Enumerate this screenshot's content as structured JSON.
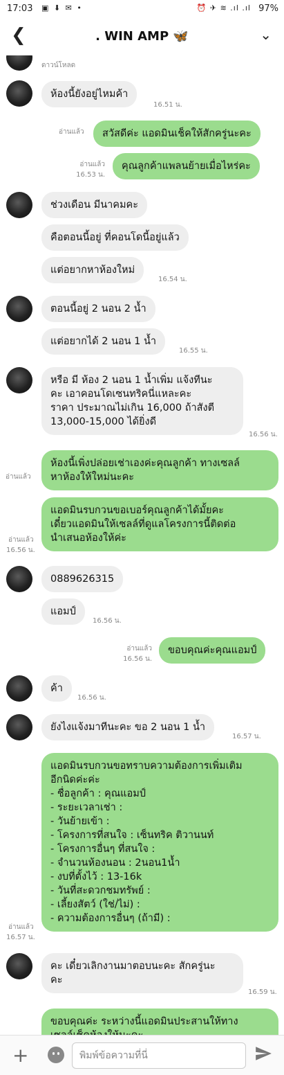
{
  "status": {
    "time": "17:03",
    "left_icons": "▣ ⬇ ✉ •",
    "right_icons": "⏰ ✈ ≋ .ıl .ıl",
    "battery": "97%"
  },
  "header": {
    "back": "❮",
    "title": ". WIN AMP 🦋",
    "chevron": "⌄"
  },
  "chat": {
    "first_caption": "ดาวน์โหลด",
    "m1": {
      "text": "ห้องนี้ยังอยู่ไหมค้า",
      "time": "16.51 น."
    },
    "m2": {
      "read": "อ่านแล้ว",
      "text": "สวัสดีค่ะ แอดมินเช็คให้สักครู่นะคะ"
    },
    "m3": {
      "read": "อ่านแล้ว",
      "time": "16.53 น.",
      "text": "คุณลูกค้าแพลนย้ายเมื่อไหร่คะ"
    },
    "m4": {
      "text": "ช่วงเดือน มีนาคมคะ"
    },
    "m5": {
      "text": "คือตอนนี้อยู่ ที่คอนโดนี้อยู่แล้ว"
    },
    "m6": {
      "text": "แต่อยากหาห้องใหม่",
      "time": "16.54 น."
    },
    "m7": {
      "text": "ตอนนี้อยู่ 2 นอน 2 น้ำ"
    },
    "m8": {
      "text": "แต่อยากได้ 2 นอน 1 น้ำ",
      "time": "16.55 น."
    },
    "m9": {
      "text": "หรือ มี ห้อง 2 นอน 1 น้ำเพิ่ม แจ้งทีนะ\nคะ เอาคอนโดเซนทริคนี่แหละคะ\nราคา ประมาณไม่เกิน 16,000 ถ้าสังตี\n13,000-15,000 ได้ยิ่งดี",
      "time": "16.56 น."
    },
    "m10": {
      "read": "อ่านแล้ว",
      "text": "ห้องนี้เพิ่งปล่อยเช่าเองค่ะคุณลูกค้า ทางเซลล์\nหาห้องให้ใหม่นะคะ"
    },
    "m11": {
      "read": "อ่านแล้ว",
      "time": "16.56 น.",
      "text": "แอดมินรบกวนขอเบอร์คุณลูกค้าได้มั้ยคะ\nเดี๋ยวแอดมินให้เซลล์ที่ดูแลโครงการนี้ติดต่อ\nนำเสนอห้องให้ค่ะ"
    },
    "m12": {
      "text": "0889626315"
    },
    "m13": {
      "text": "แอมป์",
      "time": "16.56 น."
    },
    "m14": {
      "read": "อ่านแล้ว",
      "time": "16.56 น.",
      "text": "ขอบคุณค่ะคุณแอมป์"
    },
    "m15": {
      "text": "ค้า",
      "time": "16.56 น."
    },
    "m16": {
      "text": "ยังไงแจ้งมาทีนะคะ ขอ 2 นอน 1 น้ำ",
      "time": "16.57 น."
    },
    "m17": {
      "read": "อ่านแล้ว",
      "time": "16.57 น.",
      "text": "แอดมินรบกวนขอทราบความต้องการเพิ่มเติม\nอีกนิดค่ะค่ะ\n- ชื่อลูกค้า : คุณแอมป์\n- ระยะเวลาเช่า :\n- วันย้ายเข้า :\n- โครงการที่สนใจ : เซ็นทริค ติวานนท์\n- โครงการอื่นๆ ที่สนใจ :\n- จำนวนห้องนอน : 2นอน1น้ำ\n- งบที่ตั้งไว้ : 13-16k\n- วันที่สะดวกชมทรัพย์ :\n- เลี้ยงสัตว์ (ใช่/ไม่) :\n- ความต้องการอื่นๆ (ถ้ามี) :"
    },
    "m18": {
      "text": "คะ เดี๋ยวเลิกงานมาตอบนะคะ สักครู่นะ\nคะ",
      "time": "16.59 น."
    },
    "m19": {
      "text": "ขอบคุณค่ะ ระหว่างนี้แอดมินประสานให้ทาง\nเซลล์เช็คห้องให้นะคะ"
    }
  },
  "composer": {
    "plus": "+",
    "placeholder": "พิมพ์ข้อความที่นี่"
  }
}
